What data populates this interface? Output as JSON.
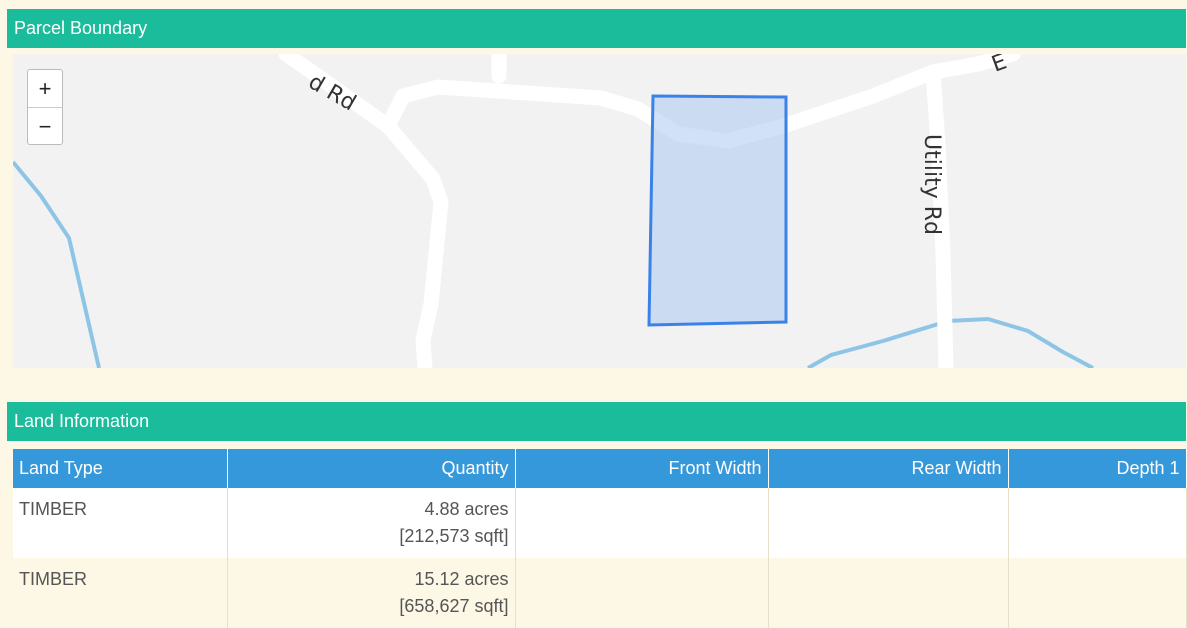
{
  "parcel_boundary": {
    "title": "Parcel Boundary",
    "zoom_in_label": "+",
    "zoom_out_label": "−",
    "road_labels": {
      "left_partial": "d Rd",
      "utility": "Utility Rd",
      "top_right_partial": "E"
    }
  },
  "land_information": {
    "title": "Land Information",
    "columns": [
      "Land Type",
      "Quantity",
      "Front Width",
      "Rear Width",
      "Depth 1"
    ],
    "rows": [
      {
        "land_type": "TIMBER",
        "acres": "4.88 acres",
        "sqft": "[212,573 sqft]",
        "front_width": "",
        "rear_width": "",
        "depth1": ""
      },
      {
        "land_type": "TIMBER",
        "acres": "15.12 acres",
        "sqft": "[658,627 sqft]",
        "front_width": "",
        "rear_width": "",
        "depth1": ""
      }
    ]
  }
}
